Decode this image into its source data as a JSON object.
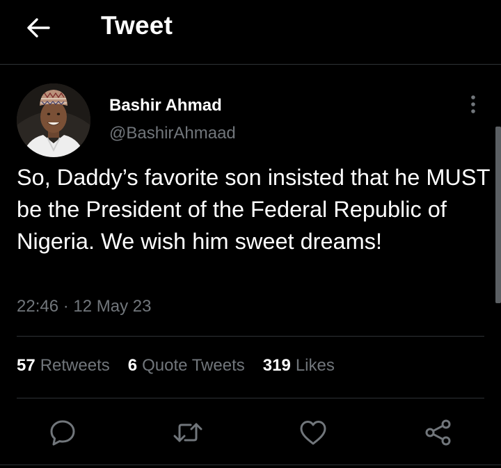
{
  "header": {
    "title": "Tweet",
    "back_icon": "arrow-left-icon"
  },
  "tweet": {
    "author": {
      "name": "Bashir Ahmad",
      "handle": "@BashirAhmaad",
      "avatar_icon": "profile-photo"
    },
    "text": "So, Daddy’s favorite son insisted that he MUST be the President of the Federal Republic of Nigeria. We wish him sweet dreams!",
    "timestamp": "22:46 · 12 May 23",
    "stats": {
      "retweets_count": "57",
      "retweets_label": "Retweets",
      "quotes_count": "6",
      "quotes_label": "Quote Tweets",
      "likes_count": "319",
      "likes_label": "Likes"
    },
    "actions": [
      "reply-icon",
      "retweet-icon",
      "like-icon",
      "share-icon"
    ]
  },
  "colors": {
    "background": "#000000",
    "text": "#ffffff",
    "secondary_text": "#71767b",
    "divider": "#2f3336"
  }
}
